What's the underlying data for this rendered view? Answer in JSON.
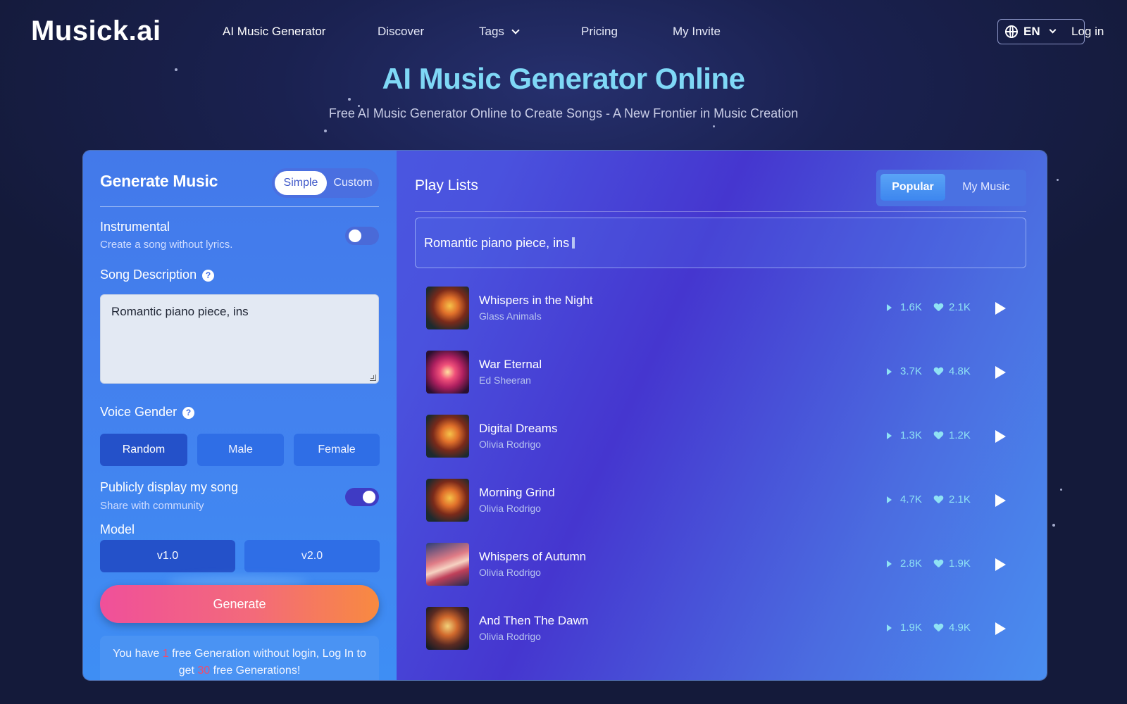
{
  "nav": {
    "logo": "Musick.ai",
    "links": [
      "AI Music Generator",
      "Discover",
      "Tags",
      "Pricing",
      "My Invite"
    ],
    "language": "EN",
    "login": "Log in"
  },
  "hero": {
    "title": "AI Music Generator Online",
    "subtitle": "Free AI Music Generator Online to Create Songs - A New Frontier in Music Creation"
  },
  "generate_panel": {
    "title": "Generate Music",
    "mode_simple": "Simple",
    "mode_custom": "Custom",
    "instrumental_label": "Instrumental",
    "instrumental_hint": "Create a song without lyrics.",
    "instrumental_on": false,
    "song_description_label": "Song Description",
    "song_description_value": "Romantic piano piece, ins",
    "voice_gender_label": "Voice Gender",
    "voice_options": [
      "Random",
      "Male",
      "Female"
    ],
    "voice_selected": "Random",
    "public_label": "Publicly display my song",
    "public_hint": "Share with community",
    "public_on": true,
    "model_label": "Model",
    "model_options": [
      "v1.0",
      "v2.0"
    ],
    "model_selected": "v1.0",
    "generate_button": "Generate",
    "notice_part1": "You have ",
    "notice_count1": "1",
    "notice_part2": " free Generation without login, Log In to get ",
    "notice_count2": "30",
    "notice_part3": " free Generations!"
  },
  "playlist": {
    "title": "Play Lists",
    "tab_popular": "Popular",
    "tab_my_music": "My Music",
    "search_value": "Romantic piano piece, ins",
    "tracks": [
      {
        "title": "Whispers in the Night",
        "artist": "Glass Animals",
        "plays": "1.6K",
        "likes": "2.1K",
        "cover": "phoenix"
      },
      {
        "title": "War Eternal",
        "artist": "Ed Sheeran",
        "plays": "3.7K",
        "likes": "4.8K",
        "cover": "flower"
      },
      {
        "title": "Digital Dreams",
        "artist": "Olivia Rodrigo",
        "plays": "1.3K",
        "likes": "1.2K",
        "cover": "phoenix"
      },
      {
        "title": "Morning Grind",
        "artist": "Olivia Rodrigo",
        "plays": "4.7K",
        "likes": "2.1K",
        "cover": "phoenix"
      },
      {
        "title": "Whispers of Autumn",
        "artist": "Olivia Rodrigo",
        "plays": "2.8K",
        "likes": "1.9K",
        "cover": "wave"
      },
      {
        "title": "And Then The Dawn",
        "artist": "Olivia Rodrigo",
        "plays": "1.9K",
        "likes": "4.9K",
        "cover": "feathers"
      }
    ]
  },
  "colors": {
    "accent_title": "#7fd8f6",
    "stat_cyan": "#8fe2f4",
    "notice_red": "#f04b6e"
  }
}
